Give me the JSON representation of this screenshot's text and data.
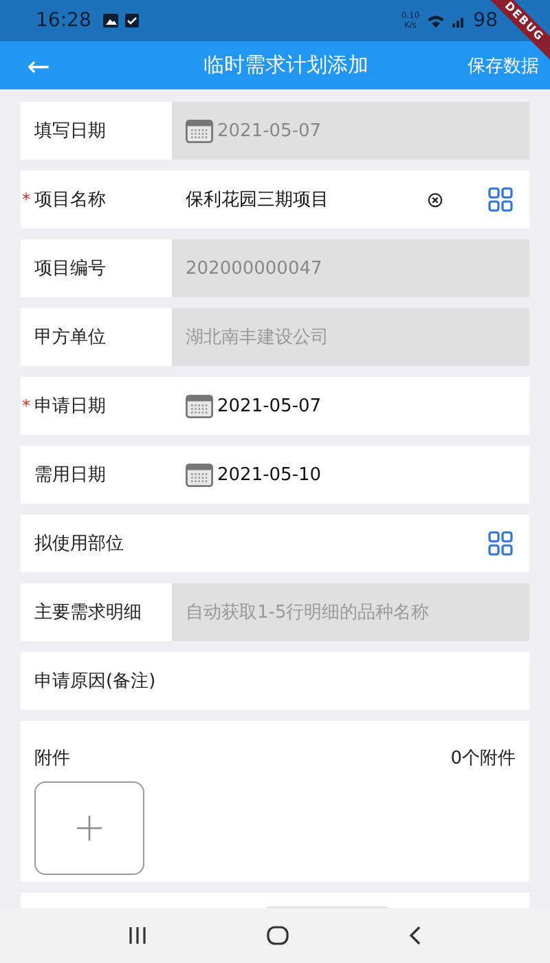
{
  "status_bar": {
    "time": "16:28",
    "speed_value": "0.10",
    "speed_unit": "K/s",
    "battery": "98"
  },
  "debug_banner": "DEBUG",
  "required_mark": "*",
  "app_bar": {
    "back": "←",
    "title": "临时需求计划添加",
    "action": "保存数据"
  },
  "fields": [
    {
      "kind": "date",
      "label": "填写日期",
      "required": false,
      "disabled": true,
      "value": "2021-05-07"
    },
    {
      "kind": "picker",
      "label": "项目名称",
      "required": true,
      "disabled": false,
      "value": "保利花园三期项目",
      "clearable": true
    },
    {
      "kind": "text",
      "label": "项目编号",
      "required": false,
      "disabled": true,
      "value": "202000000047"
    },
    {
      "kind": "text",
      "label": "甲方单位",
      "required": false,
      "disabled": true,
      "placeholder": "湖北南丰建设公司"
    },
    {
      "kind": "date",
      "label": "申请日期",
      "required": true,
      "disabled": false,
      "value": "2021-05-07"
    },
    {
      "kind": "date",
      "label": "需用日期",
      "required": false,
      "disabled": false,
      "value": "2021-05-10"
    },
    {
      "kind": "picker",
      "label": "拟使用部位",
      "required": false,
      "disabled": false
    },
    {
      "kind": "text",
      "label": "主要需求明细",
      "required": false,
      "disabled": true,
      "placeholder": "自动获取1-5行明细的品种名称"
    },
    {
      "kind": "text",
      "label": "申请原因(备注)",
      "required": false,
      "disabled": false
    }
  ],
  "attachments": {
    "label": "附件",
    "count": "0个附件"
  }
}
